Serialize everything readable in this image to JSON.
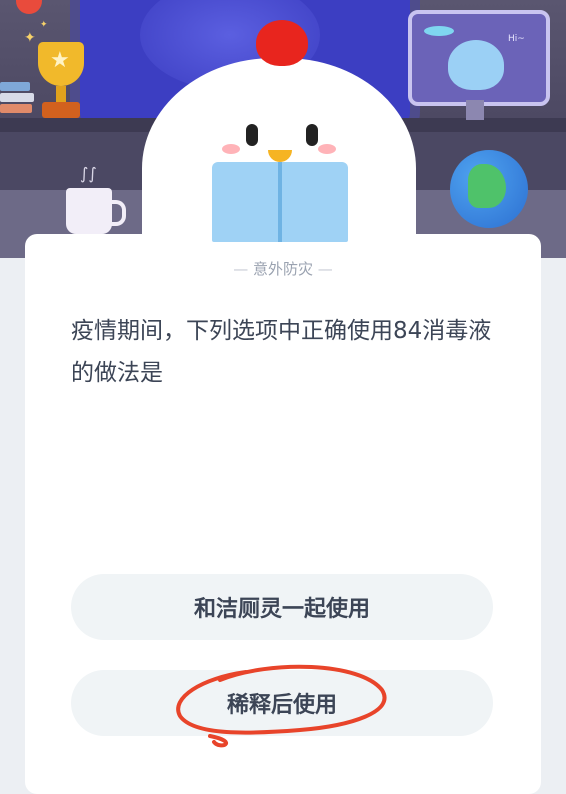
{
  "monitor": {
    "greeting": "Hi~"
  },
  "quiz": {
    "category": "意外防灾",
    "question": "疫情期间，下列选项中正确使用84消毒液的做法是",
    "options": [
      {
        "label": "和洁厕灵一起使用"
      },
      {
        "label": "稀释后使用",
        "circled": true
      }
    ]
  },
  "colors": {
    "annotation": "#e8442a",
    "option_bg": "#f0f4f6",
    "text": "#3c4556",
    "muted": "#9aa2b0"
  }
}
